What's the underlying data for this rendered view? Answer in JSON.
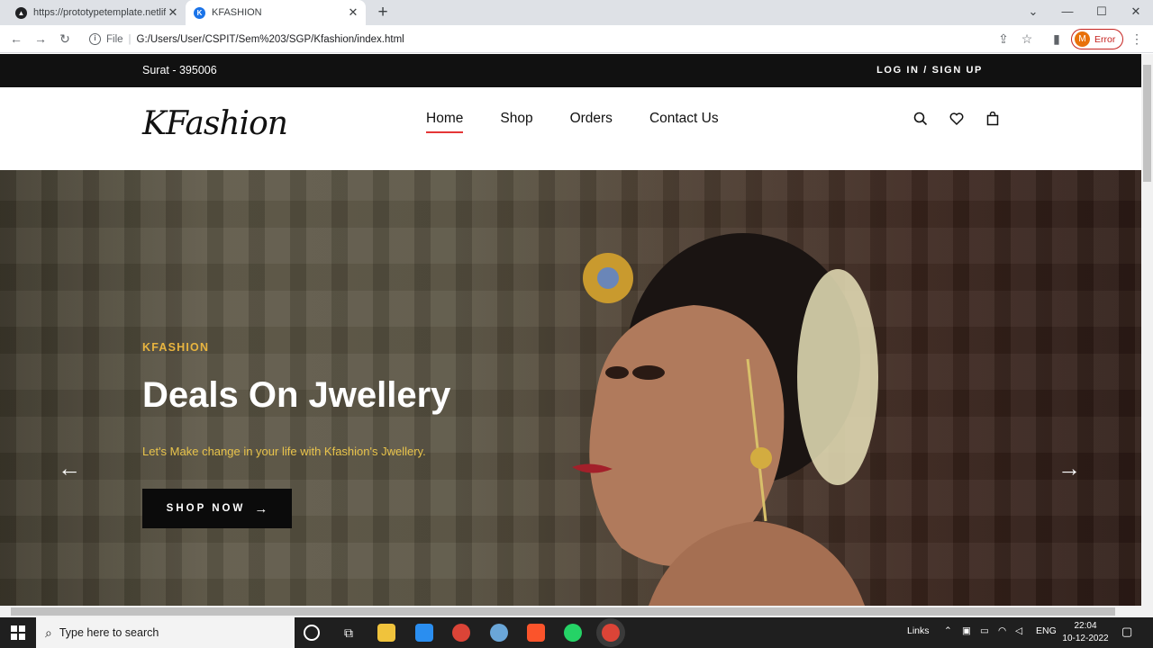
{
  "browser": {
    "tabs": [
      {
        "title": "https://prototypetemplate.netlify",
        "active": false
      },
      {
        "title": "KFASHION",
        "active": true
      }
    ],
    "url_scheme": "File",
    "url": "G:/Users/User/CSPIT/Sem%203/SGP/Kfashion/index.html",
    "profile_initial": "M",
    "profile_status": "Error"
  },
  "site": {
    "topbar": {
      "location": "Surat - 395006",
      "auth_link": "LOG IN / SIGN UP"
    },
    "logo": "KFashion",
    "menu": [
      {
        "label": "Home",
        "active": true
      },
      {
        "label": "Shop",
        "active": false
      },
      {
        "label": "Orders",
        "active": false
      },
      {
        "label": "Contact Us",
        "active": false
      }
    ],
    "header_icons": [
      "search-icon",
      "heart-icon",
      "bag-icon"
    ],
    "hero": {
      "tag": "KFASHION",
      "headline": "Deals On Jwellery",
      "subline": "Let's Make change in your life with Kfashion's Jwellery.",
      "button": "SHOP NOW"
    }
  },
  "taskbar": {
    "search_placeholder": "Type here to search",
    "links_label": "Links",
    "language": "ENG",
    "time": "22:04",
    "date": "10-12-2022"
  },
  "colors": {
    "accent": "#e53637",
    "gold": "#e8b43f",
    "topbar": "#111111"
  }
}
